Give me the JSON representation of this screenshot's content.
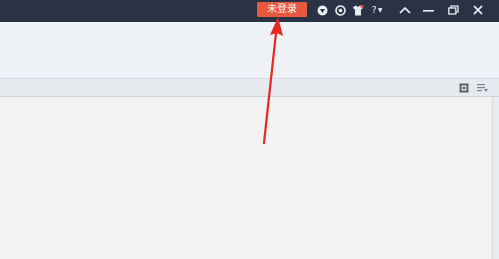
{
  "titlebar": {
    "login_label": "未登录",
    "help_label": "?",
    "icons": [
      "shield-icon",
      "refresh-icon",
      "shirt-icon",
      "help-icon",
      "collapse-icon",
      "minimize-icon",
      "restore-icon",
      "close-icon"
    ]
  },
  "panel": {
    "icons": [
      "view-icon",
      "filter-icon"
    ]
  },
  "colors": {
    "titlebar_bg": "#2a3346",
    "login_btn_bg": "#e8583e",
    "annotation_arrow": "#e8281c",
    "content_bg": "#f2f2f2"
  }
}
